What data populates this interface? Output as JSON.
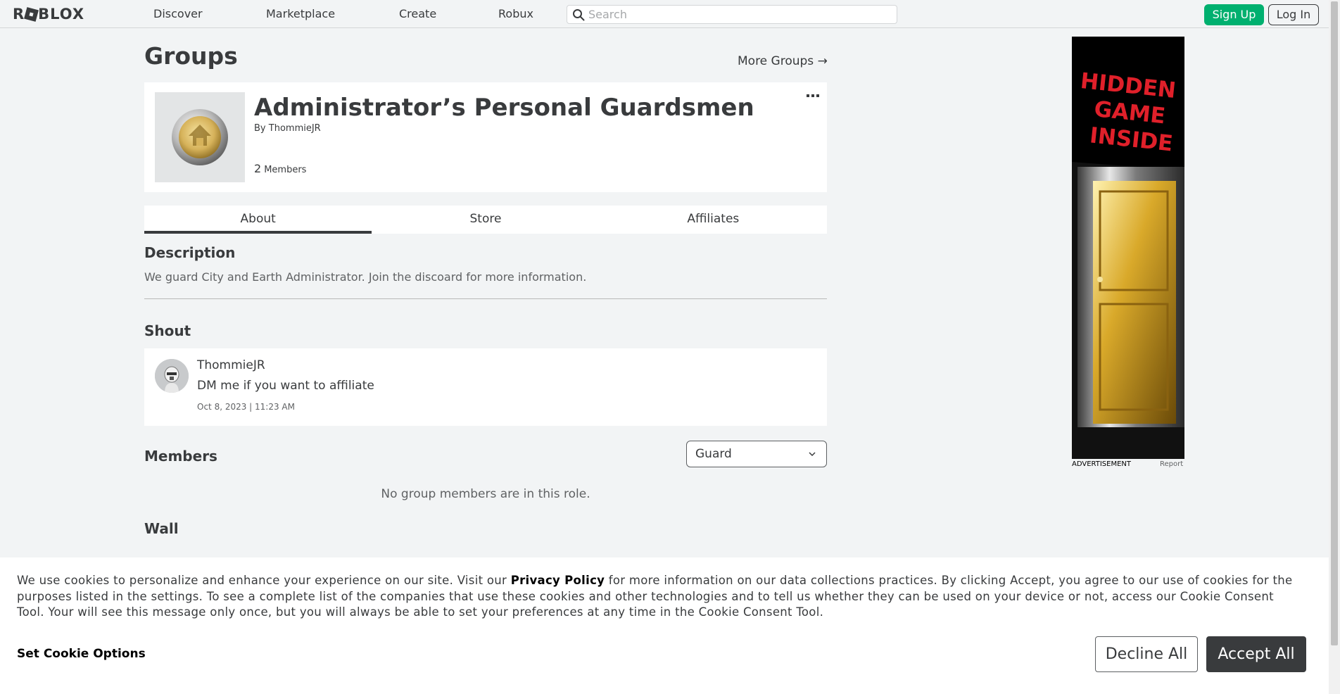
{
  "nav": {
    "logo": "ROBLOX",
    "links": [
      "Discover",
      "Marketplace",
      "Create",
      "Robux"
    ],
    "search_placeholder": "Search",
    "sign_up": "Sign Up",
    "log_in": "Log In"
  },
  "page": {
    "title": "Groups",
    "more_groups": "More Groups →"
  },
  "group": {
    "name": "Administrator’s Personal Guardsmen",
    "by_label": "By",
    "owner": "ThommieJR",
    "member_count": "2",
    "members_label": "Members"
  },
  "tabs": [
    "About",
    "Store",
    "Affiliates"
  ],
  "description": {
    "title": "Description",
    "text": "We guard City and Earth Administrator. Join the discoard for more information."
  },
  "shout": {
    "title": "Shout",
    "user": "ThommieJR",
    "message": "DM me if you want to affiliate",
    "timestamp": "Oct 8, 2023 | 11:23 AM"
  },
  "members": {
    "title": "Members",
    "role_selected": "Guard",
    "empty_text": "No group members are in this role."
  },
  "wall": {
    "title": "Wall"
  },
  "ad": {
    "headline_line1": "HIDDEN",
    "headline_line2": "GAME",
    "headline_line3": "INSIDE",
    "label": "ADVERTISEMENT",
    "report": "Report"
  },
  "cookie": {
    "text_before": "We use cookies to personalize and enhance your experience on our site. Visit our ",
    "privacy_link": "Privacy Policy",
    "text_after": " for more information on our data collections practices. By clicking Accept, you agree to our use of cookies for the purposes listed in the settings. To see a complete list of the companies that use these cookies and other technologies and to tell us whether they can be used on your device or not, access our Cookie Consent Tool. Your will see this message only once, but you will always be able to set your preferences at any time in the Cookie Consent Tool.",
    "set_options": "Set Cookie Options",
    "decline": "Decline All",
    "accept": "Accept All"
  },
  "colors": {
    "primary_green": "#00b06f",
    "text_dark": "#393b3d",
    "background": "#f2f4f5",
    "ad_headline": "#e0202a",
    "door_gold": "#c9a227"
  }
}
